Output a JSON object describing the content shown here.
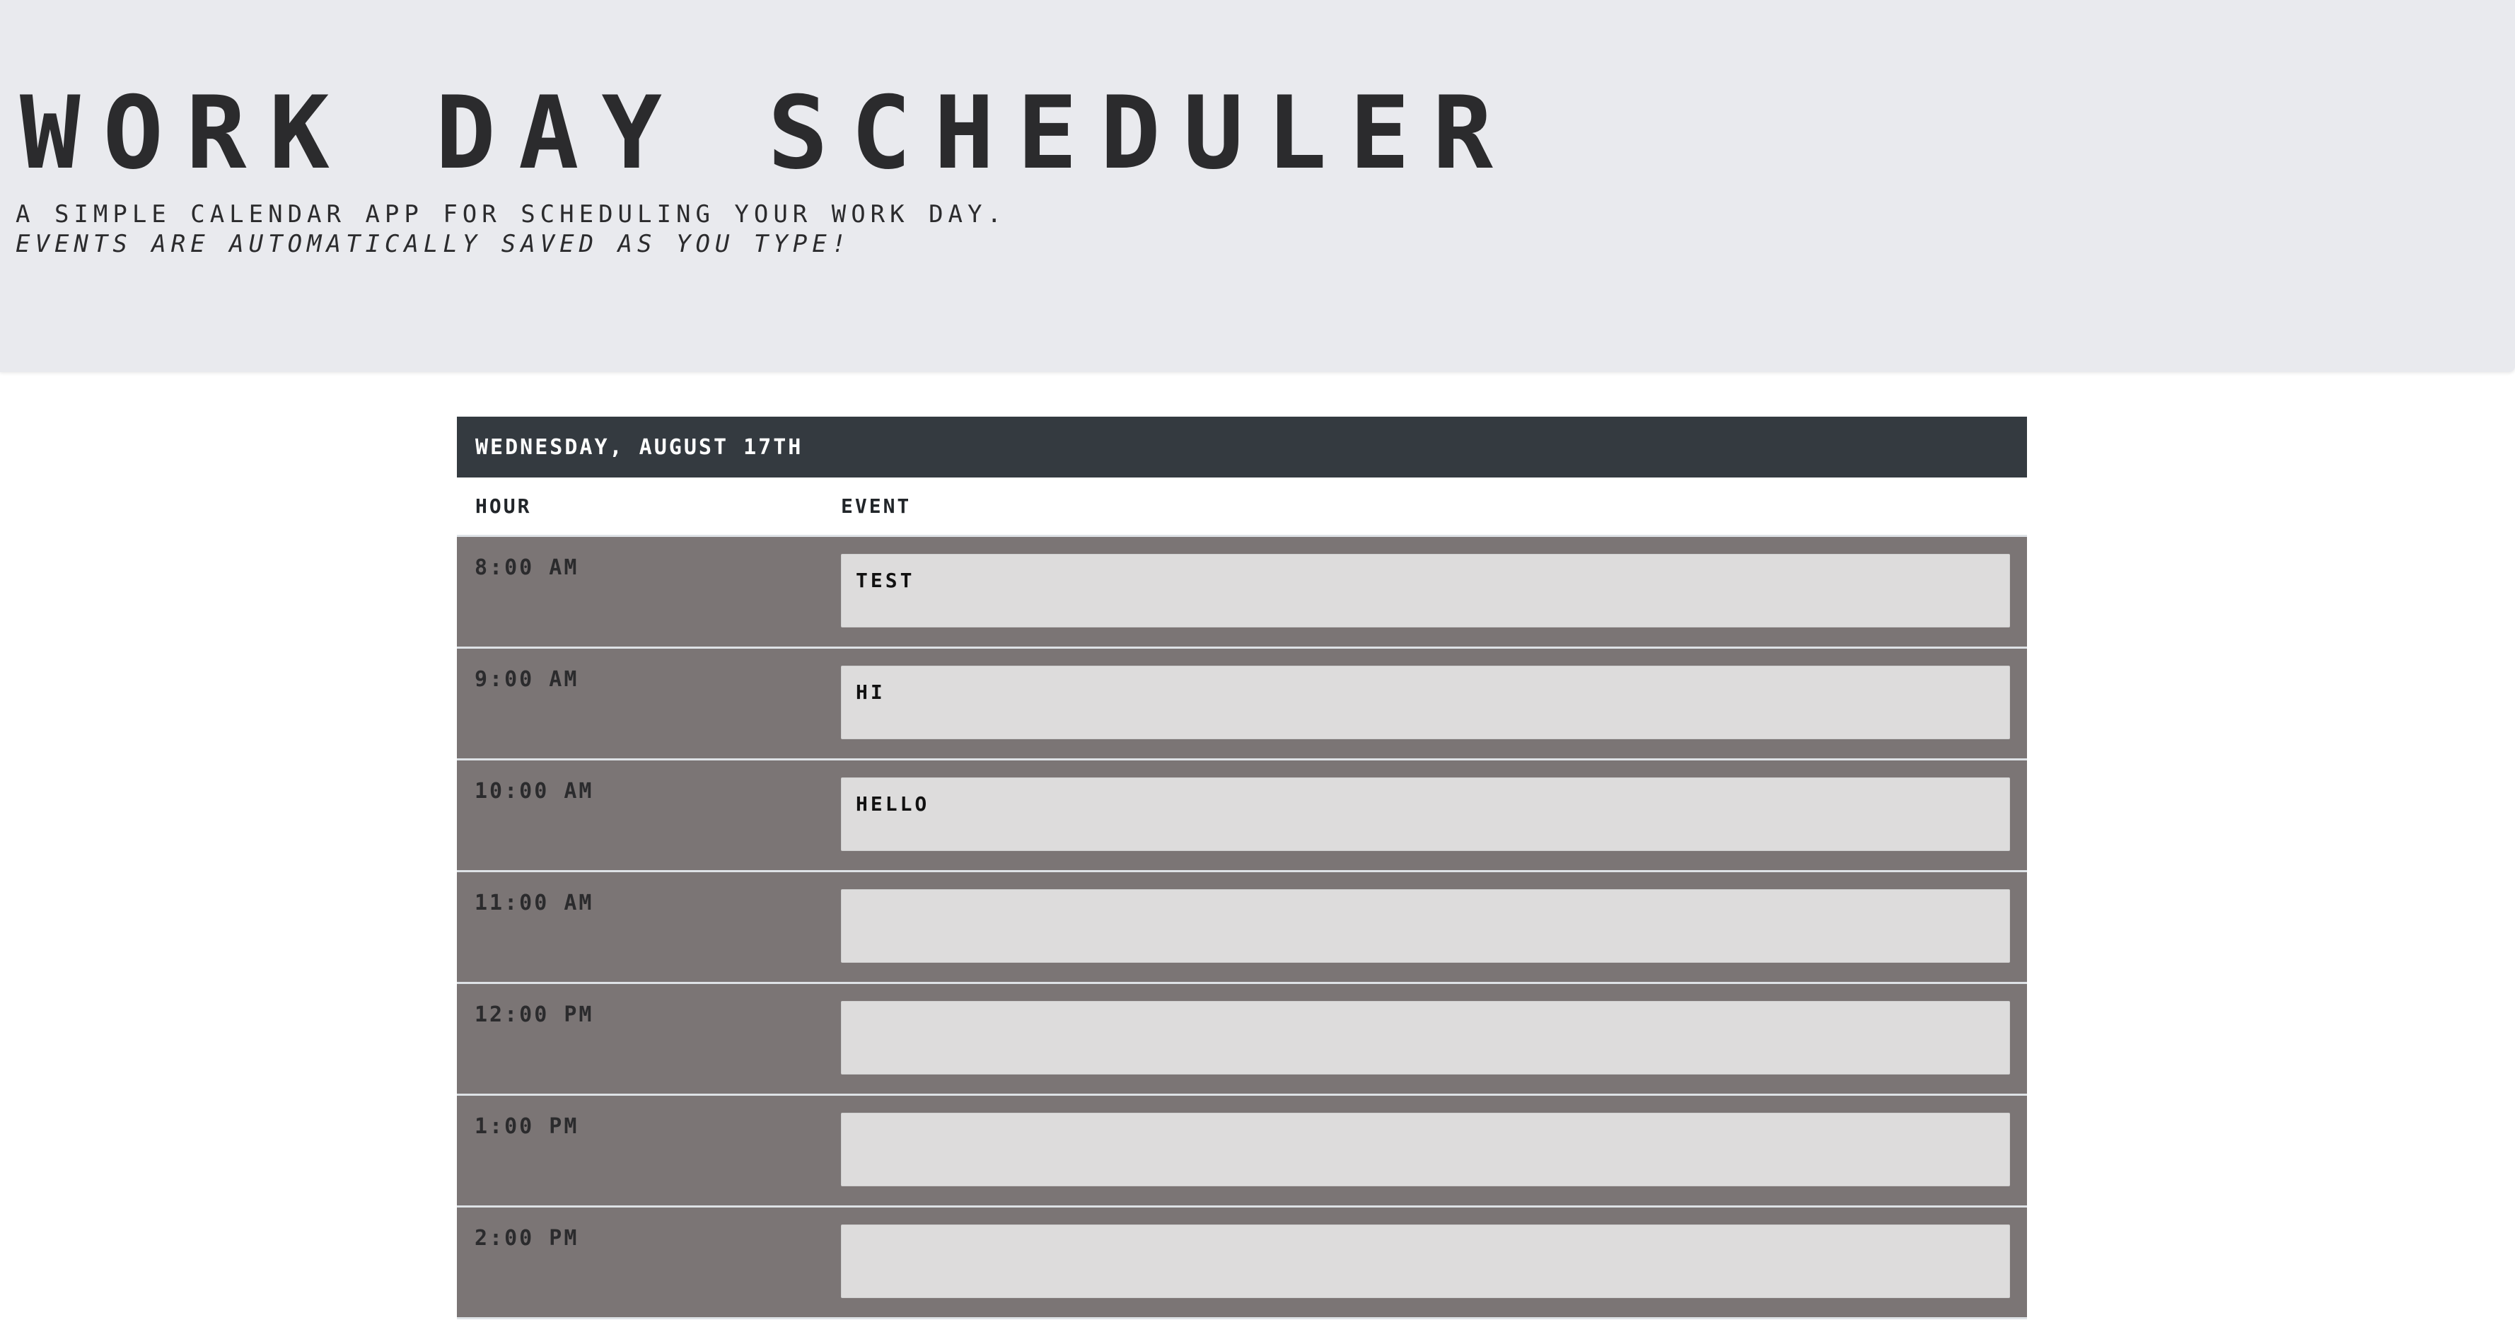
{
  "header": {
    "title": "WORK DAY SCHEDULER",
    "lead_line1": "A SIMPLE CALENDAR APP FOR SCHEDULING YOUR WORK DAY.",
    "lead_line2": "EVENTS ARE AUTOMATICALLY SAVED AS YOU TYPE!"
  },
  "schedule": {
    "date": "WEDNESDAY, AUGUST 17TH",
    "col_hour": "HOUR",
    "col_event": "EVENT",
    "rows": [
      {
        "hour": "8:00 AM",
        "event": "TEST"
      },
      {
        "hour": "9:00 AM",
        "event": "HI"
      },
      {
        "hour": "10:00 AM",
        "event": "HELLO"
      },
      {
        "hour": "11:00 AM",
        "event": ""
      },
      {
        "hour": "12:00 PM",
        "event": ""
      },
      {
        "hour": "1:00 PM",
        "event": ""
      },
      {
        "hour": "2:00 PM",
        "event": ""
      }
    ]
  },
  "colors": {
    "hero_bg": "#e9eaee",
    "date_bar_bg": "#343a40",
    "row_bg": "#7b7575",
    "input_bg": "#dddcdc"
  }
}
